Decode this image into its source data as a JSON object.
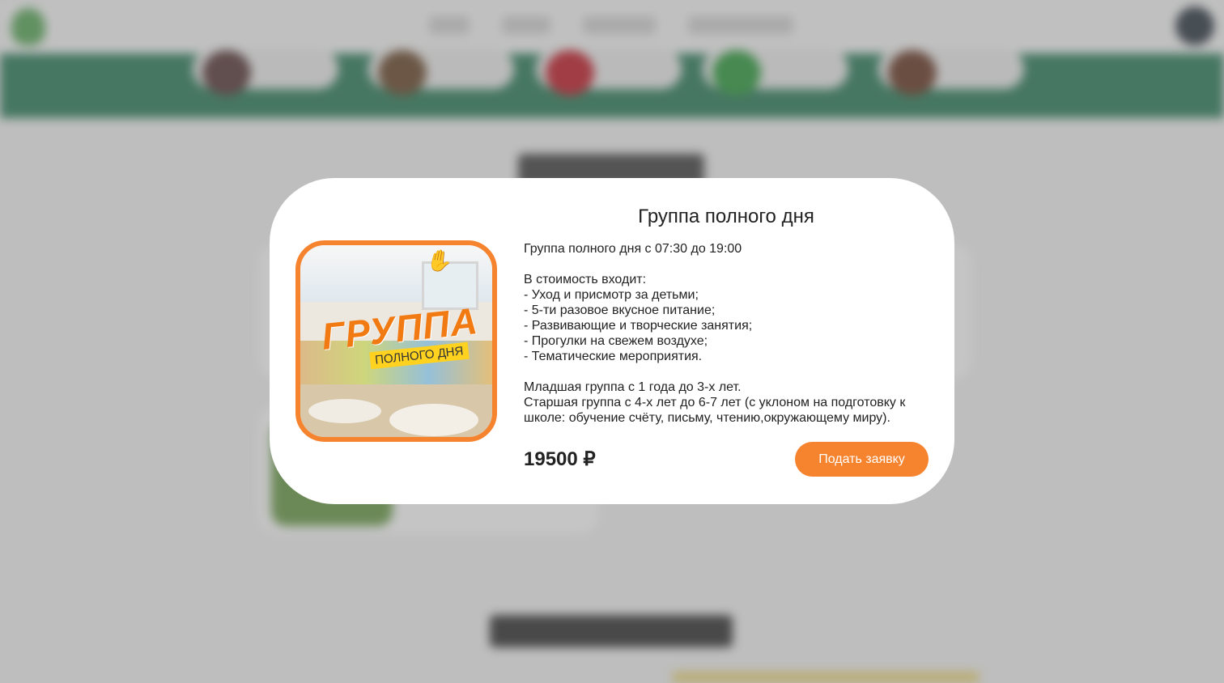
{
  "modal": {
    "title": "Группа полного дня",
    "image": {
      "big_text": "ГРУППА",
      "tagline": "ПОЛНОГО ДНЯ",
      "icon": "hand-icon"
    },
    "description": {
      "line1": "Группа полного дня с 07:30 до 19:00",
      "includes_heading": "В стоимость входит:",
      "includes": [
        "- Уход и присмотр за детьми;",
        "- 5-ти разовое вкусное питание;",
        "- Развивающие и творческие занятия;",
        "- Прогулки на свежем воздухе;",
        "- Тематические мероприятия."
      ],
      "junior": "Младшая группа с 1 года до 3-х лет.",
      "senior": "Старшая группа с 4-х лет до 6-7 лет (с уклоном на подготовку к школе: обучение счёту, письму, чтению,окружающему миру)."
    },
    "price": "19500 ₽",
    "apply_button": "Подать заявку"
  },
  "colors": {
    "accent": "#f6832e",
    "band_green": "#2e7d5b",
    "overlay": "rgba(110,110,110,0.38)"
  }
}
